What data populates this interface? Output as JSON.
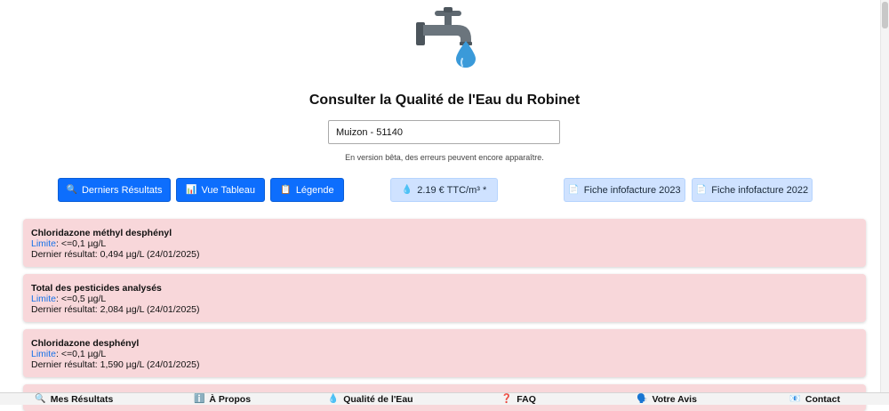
{
  "page": {
    "title": "Consulter la Qualité de l'Eau du Robinet",
    "beta_notice": "En version bêta, des erreurs peuvent encore apparaître."
  },
  "search": {
    "value": "Muizon - 51140"
  },
  "toolbar": {
    "latest_results": {
      "icon": "🔍",
      "label": "Derniers Résultats"
    },
    "table_view": {
      "icon": "📊",
      "label": "Vue Tableau"
    },
    "legend": {
      "icon": "📋",
      "label": "Légende"
    },
    "price": {
      "icon": "💧",
      "label": "2.19 € TTC/m³ *"
    },
    "invoice_2023": {
      "icon": "📄",
      "label": "Fiche infofacture 2023"
    },
    "invoice_2022": {
      "icon": "📄",
      "label": "Fiche infofacture 2022"
    }
  },
  "results": [
    {
      "name": "Chloridazone méthyl desphényl",
      "limit_label": "Limite",
      "limit": ": <=0,1 µg/L",
      "last": "Dernier résultat: 0,494 µg/L (24/01/2025)"
    },
    {
      "name": "Total des pesticides analysés",
      "limit_label": "Limite",
      "limit": ": <=0,5 µg/L",
      "last": "Dernier résultat: 2,084 µg/L (24/01/2025)"
    },
    {
      "name": "Chloridazone desphényl",
      "limit_label": "Limite",
      "limit": ": <=0,1 µg/L",
      "last": "Dernier résultat: 1,590 µg/L (24/01/2025)"
    }
  ],
  "bottom_nav": [
    {
      "icon": "🔍",
      "label": "Mes Résultats"
    },
    {
      "icon": "ℹ️",
      "label": "À Propos"
    },
    {
      "icon": "💧",
      "label": "Qualité de l'Eau"
    },
    {
      "icon": "❓",
      "label": "FAQ"
    },
    {
      "icon": "🗣️",
      "label": "Votre Avis"
    },
    {
      "icon": "📧",
      "label": "Contact"
    }
  ],
  "colors": {
    "primary": "#0d6efd",
    "light_button": "#cfe2ff",
    "alert_card": "#f8d7da",
    "limit_link": "#1a73e8"
  }
}
